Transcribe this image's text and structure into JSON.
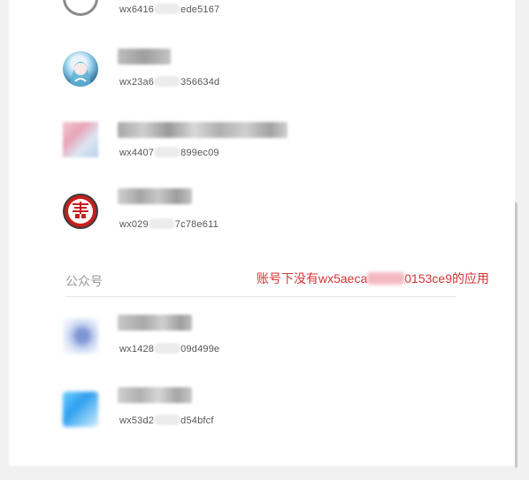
{
  "apps": [
    {
      "id_prefix": "wx6416",
      "id_suffix": "ede5167"
    },
    {
      "id_prefix": "wx23a6",
      "id_suffix": "356634d"
    },
    {
      "id_prefix": "wx4407",
      "id_suffix": "899ec09"
    },
    {
      "id_prefix": "wx029",
      "id_suffix": "7c78e611"
    }
  ],
  "official_accounts_section": {
    "title": "公众号",
    "note_prefix": "账号下没有wx5aeca",
    "note_suffix": "0153ce9的应用"
  },
  "official_accounts": [
    {
      "id_prefix": "wx1428",
      "id_suffix": "09d499e"
    },
    {
      "id_prefix": "wx53d2",
      "id_suffix": "d54bfcf"
    }
  ]
}
